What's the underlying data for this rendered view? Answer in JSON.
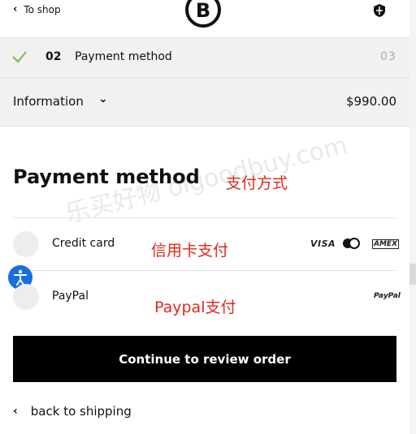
{
  "header": {
    "back_label": "To shop"
  },
  "step": {
    "number": "02",
    "title": "Payment method",
    "next_number": "03"
  },
  "info": {
    "label": "Information",
    "total": "$990.00"
  },
  "page_title": "Payment method",
  "annotations": {
    "title_note": "支付方式",
    "card_note": "信用卡支付",
    "paypal_note": "Paypal支付"
  },
  "options": [
    {
      "label": "Credit card",
      "logos": [
        "VISA",
        "mastercard-icon",
        "AMEX"
      ]
    },
    {
      "label": "PayPal",
      "logos": [
        "PayPal"
      ]
    }
  ],
  "logos": {
    "visa": "VISA",
    "amex": "AMEX",
    "paypal": "PayPal"
  },
  "cta_label": "Continue to review order",
  "back_shipping_label": "back to shipping",
  "watermark": "乐买好物 olgoodbuy.com",
  "colors": {
    "accent_green": "#6cc04a",
    "annotation_red": "#e0281b",
    "a11y_blue": "#1a6fe0",
    "cta_bg": "#000000"
  }
}
